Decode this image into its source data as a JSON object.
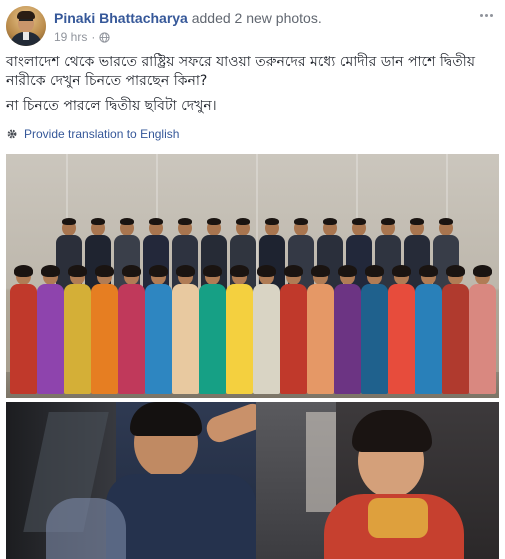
{
  "post": {
    "author": "Pinaki Bhattacharya",
    "action": "added 2 new photos.",
    "timestamp": "19 hrs",
    "separator": "·",
    "privacy_icon": "globe-icon",
    "more_icon": "more-options-icon"
  },
  "text": {
    "line1": "বাংলাদেশ থেকে ভারতে রাষ্ট্রিয় সফরে যাওয়া তরুনদের মধ্যে মোদীর ডান পাশে দ্বিতীয় নারীকে দেখুন চিনতে পারছেন কিনা?",
    "line2": "না চিনতে পারলে দ্বিতীয় ছবিটা দেখুন।"
  },
  "translation": {
    "icon": "gear-icon",
    "label": "Provide translation to English"
  },
  "colors": {
    "link": "#365899",
    "meta": "#90949c",
    "text": "#1d2129"
  }
}
